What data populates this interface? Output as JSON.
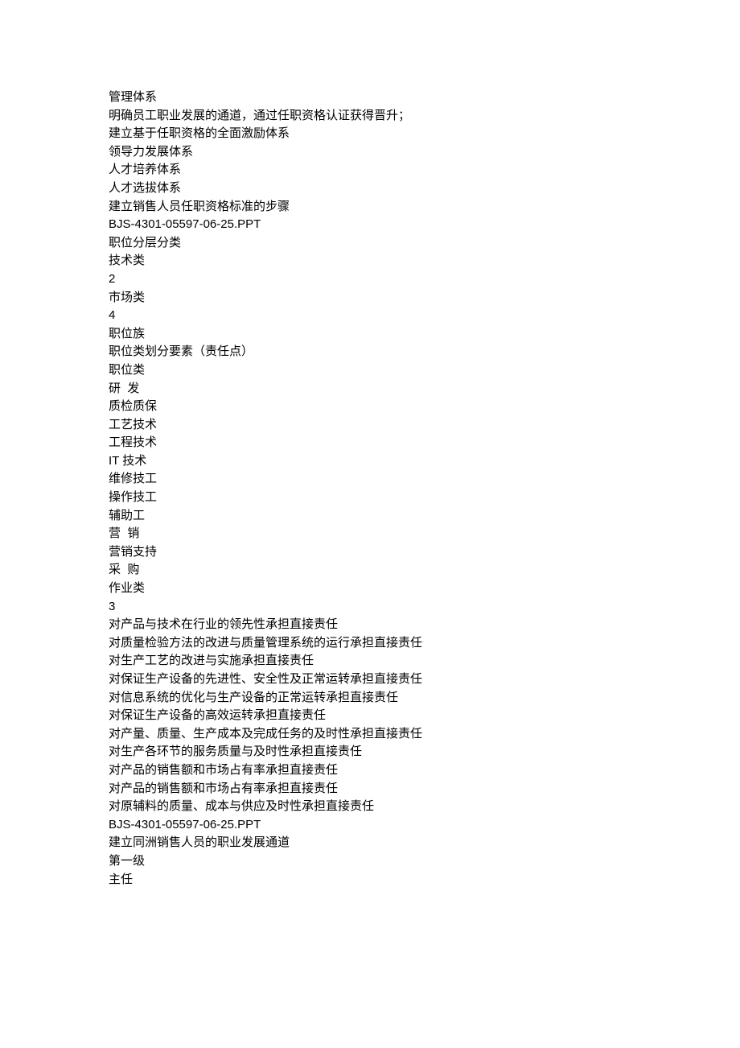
{
  "lines": [
    "管理体系",
    "明确员工职业发展的通道，通过任职资格认证获得晋升；",
    "建立基于任职资格的全面激励体系",
    "领导力发展体系",
    "人才培养体系",
    "人才选拔体系",
    "建立销售人员任职资格标准的步骤",
    "BJS-4301-05597-06-25.PPT",
    "职位分层分类",
    "技术类",
    "2",
    "市场类",
    "4",
    "职位族",
    "职位类划分要素（责任点）",
    "职位类",
    "研  发",
    "质检质保",
    "工艺技术",
    "工程技术",
    "IT 技术",
    "维修技工",
    "操作技工",
    "辅助工",
    "营  销",
    "营销支持",
    "采  购",
    "作业类",
    "3",
    "对产品与技术在行业的领先性承担直接责任",
    "对质量检验方法的改进与质量管理系统的运行承担直接责任",
    "对生产工艺的改进与实施承担直接责任",
    "对保证生产设备的先进性、安全性及正常运转承担直接责任",
    "对信息系统的优化与生产设备的正常运转承担直接责任",
    "对保证生产设备的高效运转承担直接责任",
    "对产量、质量、生产成本及完成任务的及时性承担直接责任",
    "对生产各环节的服务质量与及时性承担直接责任",
    "对产品的销售额和市场占有率承担直接责任",
    "对产品的销售额和市场占有率承担直接责任",
    "对原辅料的质量、成本与供应及时性承担直接责任",
    "BJS-4301-05597-06-25.PPT",
    "建立同洲销售人员的职业发展通道",
    "第一级",
    "主任"
  ]
}
